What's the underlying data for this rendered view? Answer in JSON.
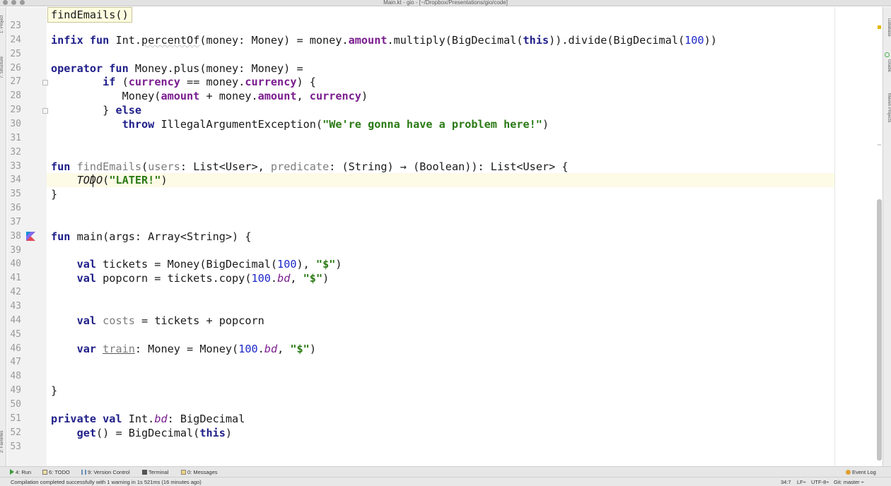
{
  "window": {
    "title": "Main.kt - gio - [~/Dropbox/Presentations/gio/code]"
  },
  "hint_popup": "findEmails()",
  "left_tabs": [
    "1: Project",
    "7: Structure",
    "2: Favorites"
  ],
  "right_tabs": [
    "Database",
    "Gradle",
    "Maven Projects"
  ],
  "editor": {
    "current_line": 34,
    "lines": [
      {
        "n": "23",
        "html": ""
      },
      {
        "n": "24",
        "html": "<span class=\"kw\">infix fun</span> Int.<span class=\"warn-under\">percentOf</span>(money: Money) = money.<span class=\"prop\">amount</span>.multiply(BigDecimal(<span class=\"kw\">this</span>)).divide(BigDecimal(<span class=\"num\">100</span>))"
      },
      {
        "n": "25",
        "html": ""
      },
      {
        "n": "26",
        "html": "<span class=\"kw\">operator fun</span> Money.plus(money: Money) ="
      },
      {
        "n": "27",
        "html": "        <span class=\"kw\">if</span> (<span class=\"prop\">currency</span> == money.<span class=\"prop\">currency</span>) {"
      },
      {
        "n": "28",
        "html": "           Money(<span class=\"prop\">amount</span> + money.<span class=\"prop\">amount</span>, <span class=\"prop\">currency</span>)"
      },
      {
        "n": "29",
        "html": "        } <span class=\"kw\">else</span>"
      },
      {
        "n": "30",
        "html": "           <span class=\"kw\">throw</span> IllegalArgumentException(<span class=\"str\">\"We're gonna have a problem here!\"</span>)"
      },
      {
        "n": "31",
        "html": ""
      },
      {
        "n": "32",
        "html": ""
      },
      {
        "n": "33",
        "html": "<span class=\"kw\">fun</span> <span class=\"decl-unused\">findEmails</span>(<span class=\"param-unused\">users</span>: List&lt;User&gt;, <span class=\"param-unused\">predicate</span>: (String) → (Boolean)): List&lt;User&gt; {"
      },
      {
        "n": "34",
        "html": "    <span class=\"italic-todo\">TODO</span>(<span class=\"str\">\"LATER!\"</span>)"
      },
      {
        "n": "35",
        "html": "}"
      },
      {
        "n": "36",
        "html": ""
      },
      {
        "n": "37",
        "html": ""
      },
      {
        "n": "38",
        "html": "<span class=\"kw\">fun</span> main(args: Array&lt;String&gt;) {"
      },
      {
        "n": "39",
        "html": ""
      },
      {
        "n": "40",
        "html": "    <span class=\"kw\">val</span> tickets = Money(BigDecimal(<span class=\"num\">100</span>), <span class=\"str\">\"$\"</span>)"
      },
      {
        "n": "41",
        "html": "    <span class=\"kw\">val</span> popcorn = tickets.copy(<span class=\"num\">100</span>.<span class=\"ext\">bd</span>, <span class=\"str\">\"$\"</span>)"
      },
      {
        "n": "42",
        "html": ""
      },
      {
        "n": "43",
        "html": ""
      },
      {
        "n": "44",
        "html": "    <span class=\"kw\">val</span> <span class=\"decl-unused\">costs</span> = tickets + popcorn"
      },
      {
        "n": "45",
        "html": ""
      },
      {
        "n": "46",
        "html": "    <span class=\"kw\">var</span> <span class=\"var-under decl-unused\">train</span>: Money = Money(<span class=\"num\">100</span>.<span class=\"ext\">bd</span>, <span class=\"str\">\"$\"</span>)"
      },
      {
        "n": "47",
        "html": ""
      },
      {
        "n": "48",
        "html": ""
      },
      {
        "n": "49",
        "html": "}"
      },
      {
        "n": "50",
        "html": ""
      },
      {
        "n": "51",
        "html": "<span class=\"kw\">private val</span> Int.<span class=\"ext\">bd</span>: BigDecimal"
      },
      {
        "n": "52",
        "html": "    <span class=\"kw\">get</span>() = BigDecimal(<span class=\"kw\">this</span>)"
      },
      {
        "n": "53",
        "html": ""
      }
    ]
  },
  "tool_windows": {
    "run": "4: Run",
    "todo": "6: TODO",
    "vcs": "9: Version Control",
    "terminal": "Terminal",
    "messages": "0: Messages",
    "event_log": "Event Log"
  },
  "status": {
    "message": "Compilation completed successfully with 1 warning in 1s 521ms (16 minutes ago)",
    "position": "34:7",
    "line_sep": "LF÷",
    "encoding": "UTF-8÷",
    "git": "Git: master ÷"
  },
  "colors": {
    "keyword": "#1f1f8a",
    "string": "#2a7a14",
    "number": "#1d27c8",
    "property": "#7a1d8e",
    "current_line_bg": "#fdfbe6"
  }
}
